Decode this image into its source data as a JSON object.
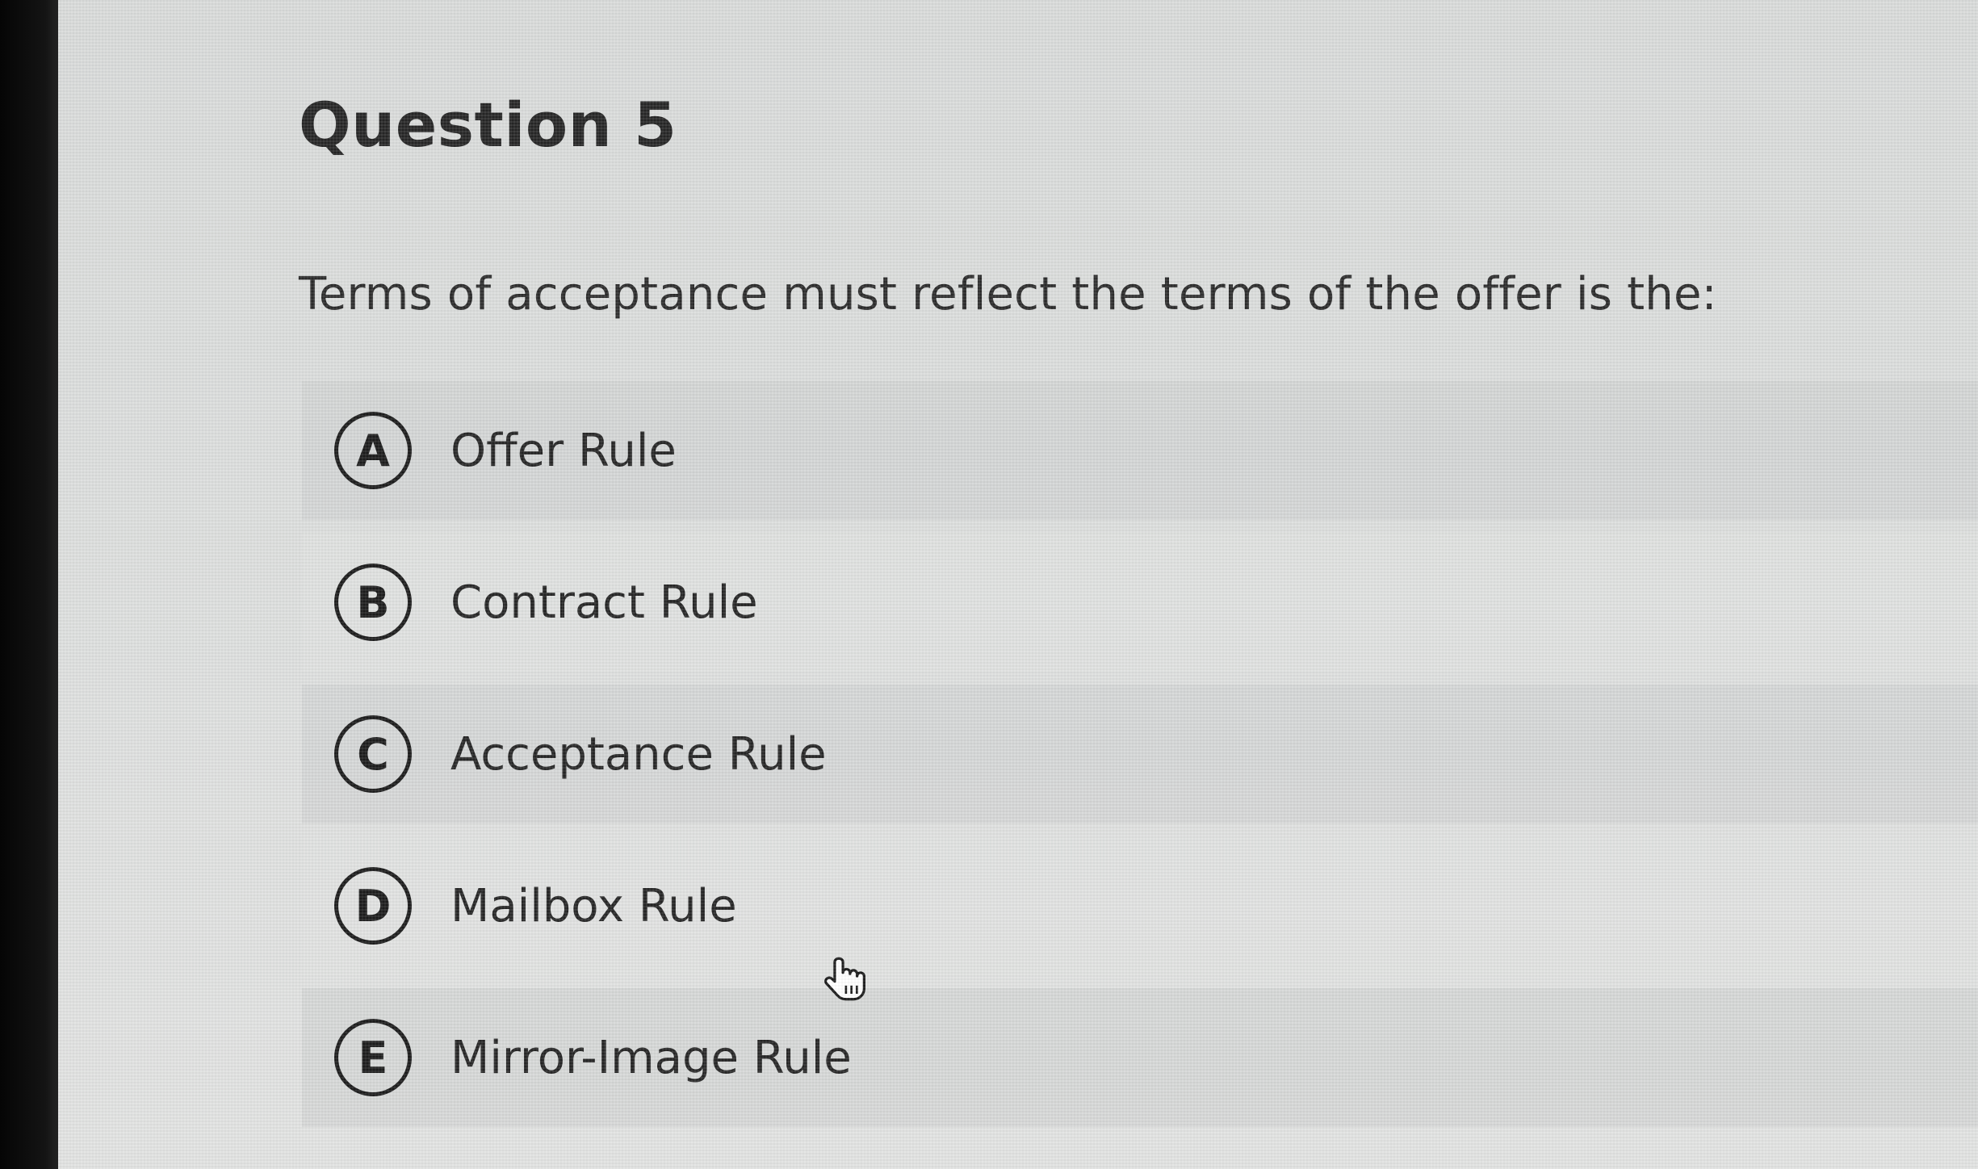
{
  "question": {
    "title": "Question 5",
    "text": "Terms of acceptance must reflect the terms of the offer is the:"
  },
  "options": [
    {
      "letter": "A",
      "label": "Offer Rule"
    },
    {
      "letter": "B",
      "label": "Contract Rule"
    },
    {
      "letter": "C",
      "label": "Acceptance Rule"
    },
    {
      "letter": "D",
      "label": "Mailbox Rule"
    },
    {
      "letter": "E",
      "label": "Mirror-Image Rule"
    }
  ],
  "cursor": {
    "icon": "hand-pointer-icon"
  },
  "colors": {
    "background": "#dcdedd",
    "text": "#262626",
    "option_border": "#1c1c1c"
  }
}
